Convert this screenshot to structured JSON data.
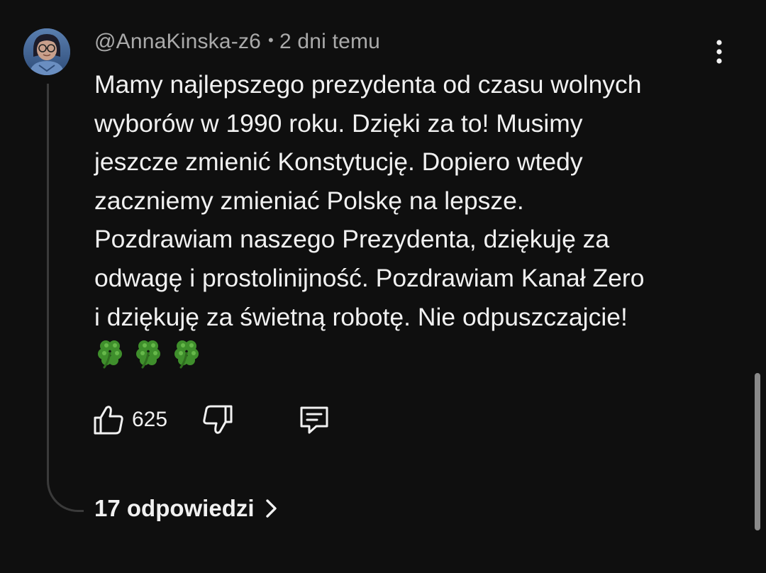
{
  "comment": {
    "author": "@AnnaKinska-z6",
    "separator": "•",
    "time": "2 dni temu",
    "text": "Mamy najlepszego prezydenta od czasu wolnych\nwyborów w 1990 roku. Dzięki za to! Musimy\njeszcze zmienić Konstytucję. Dopiero wtedy\nzaczniemy zmieniać Polskę na lepsze.\nPozdrawiam naszego Prezydenta, dziękuję za\nodwagę i prostolinijność. Pozdrawiam Kanał Zero\ni dziękuję za świetną robotę. Nie odpuszczajcie!",
    "emojis": [
      "clover-icon",
      "clover-icon",
      "clover-icon"
    ],
    "like_count": "625",
    "replies_label": "17 odpowiedzi"
  },
  "icons": {
    "menu": "more-vertical-icon",
    "like": "thumbs-up-icon",
    "dislike": "thumbs-down-icon",
    "reply": "comment-icon",
    "replies_arrow": "chevron-right-icon"
  },
  "colors": {
    "background": "#0f0f0f",
    "text": "#f1f1f1",
    "secondary_text": "#aaaaaa",
    "clover": "#3f8f2c"
  }
}
